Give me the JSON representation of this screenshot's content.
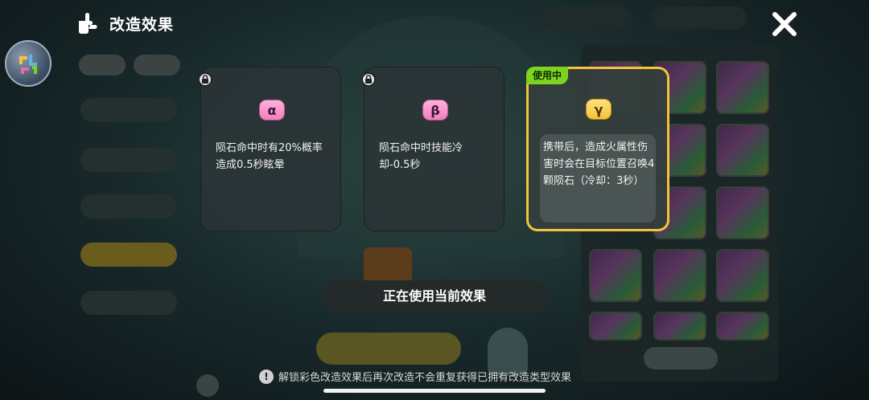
{
  "header": {
    "title": "改造效果",
    "back_icon": "back-hand-icon"
  },
  "effects": [
    {
      "symbol": "α",
      "locked": true,
      "in_use": false,
      "description": "陨石命中时有20%概率造成0.5秒眩晕"
    },
    {
      "symbol": "β",
      "locked": true,
      "in_use": false,
      "description": "陨石命中时技能冷却-0.5秒"
    },
    {
      "symbol": "γ",
      "locked": false,
      "in_use": true,
      "badge": "使用中",
      "description": "携带后，造成火属性伤害时会在目标位置召唤4颗陨石（冷却：3秒）"
    }
  ],
  "status": {
    "label": "正在使用当前效果"
  },
  "notice": {
    "text": "解锁彩色改造效果后再次改造不会重复获得已拥有改造类型效果"
  },
  "colors": {
    "accent_yellow": "#f5c33a",
    "badge_green": "#7ed321",
    "greek_pink": "#f07ec0"
  }
}
